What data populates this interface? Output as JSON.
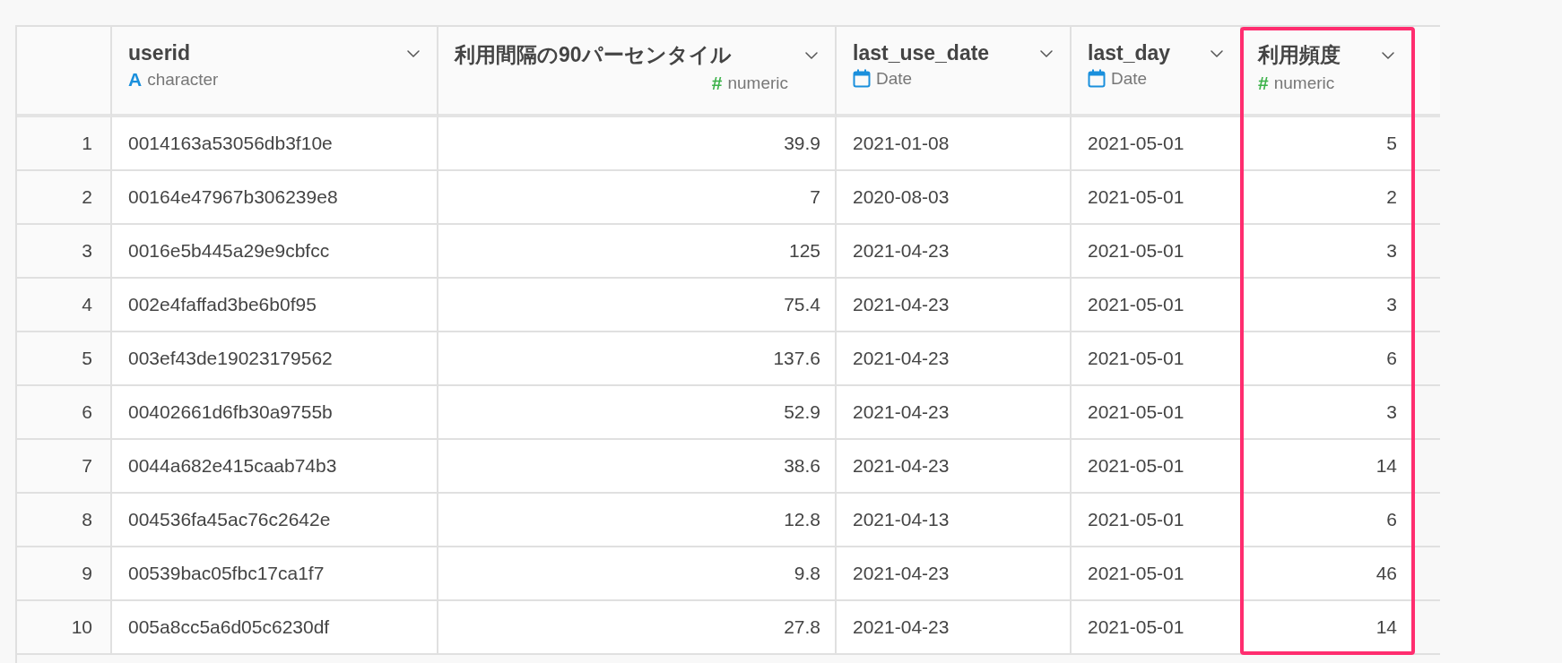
{
  "columns": [
    {
      "name": "userid",
      "kind": "character",
      "type_icon": "A",
      "type_label": "character",
      "highlighted": false
    },
    {
      "name": "利用間隔の90パーセンタイル",
      "kind": "numeric",
      "type_icon": "#",
      "type_label": "numeric",
      "highlighted": false
    },
    {
      "name": "last_use_date",
      "kind": "date",
      "type_label": "Date",
      "highlighted": false
    },
    {
      "name": "last_day",
      "kind": "date",
      "type_label": "Date",
      "highlighted": false
    },
    {
      "name": "利用頻度",
      "kind": "numeric",
      "type_icon": "#",
      "type_label": "numeric",
      "highlighted": true
    }
  ],
  "rows": [
    {
      "number": "1",
      "cells": [
        "0014163a53056db3f10e",
        "39.9",
        "2021-01-08",
        "2021-05-01",
        "5"
      ]
    },
    {
      "number": "2",
      "cells": [
        "00164e47967b306239e8",
        "7",
        "2020-08-03",
        "2021-05-01",
        "2"
      ]
    },
    {
      "number": "3",
      "cells": [
        "0016e5b445a29e9cbfcc",
        "125",
        "2021-04-23",
        "2021-05-01",
        "3"
      ]
    },
    {
      "number": "4",
      "cells": [
        "002e4faffad3be6b0f95",
        "75.4",
        "2021-04-23",
        "2021-05-01",
        "3"
      ]
    },
    {
      "number": "5",
      "cells": [
        "003ef43de19023179562",
        "137.6",
        "2021-04-23",
        "2021-05-01",
        "6"
      ]
    },
    {
      "number": "6",
      "cells": [
        "00402661d6fb30a9755b",
        "52.9",
        "2021-04-23",
        "2021-05-01",
        "3"
      ]
    },
    {
      "number": "7",
      "cells": [
        "0044a682e415caab74b3",
        "38.6",
        "2021-04-23",
        "2021-05-01",
        "14"
      ]
    },
    {
      "number": "8",
      "cells": [
        "004536fa45ac76c2642e",
        "12.8",
        "2021-04-13",
        "2021-05-01",
        "6"
      ]
    },
    {
      "number": "9",
      "cells": [
        "00539bac05fbc17ca1f7",
        "9.8",
        "2021-04-23",
        "2021-05-01",
        "46"
      ]
    },
    {
      "number": "10",
      "cells": [
        "005a8cc5a6d05c6230df",
        "27.8",
        "2021-04-23",
        "2021-05-01",
        "14"
      ]
    }
  ]
}
